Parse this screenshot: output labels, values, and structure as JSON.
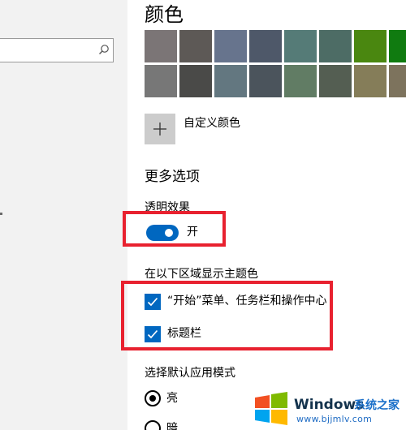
{
  "colors": {
    "heading": "颜色",
    "swatches": [
      "#7b7576",
      "#5d5956",
      "#67748d",
      "#4e5869",
      "#557b77",
      "#4d6c65",
      "#4a8710",
      "#107b10",
      "#777777",
      "#4a4a48",
      "#637780",
      "#4b545c",
      "#617c64",
      "#545e52",
      "#857d59",
      "#7d735d"
    ],
    "custom_label": "自定义颜色"
  },
  "more_options": {
    "heading": "更多选项",
    "transparency_label": "透明效果",
    "transparency_state": "开",
    "transparency_on": true,
    "accent_surfaces_label": "在以下区域显示主题色",
    "checkboxes": [
      {
        "label": "“开始”菜单、任务栏和操作中心",
        "checked": true
      },
      {
        "label": "标题栏",
        "checked": true
      }
    ]
  },
  "app_mode": {
    "label": "选择默认应用模式",
    "options": [
      {
        "label": "亮",
        "selected": true
      },
      {
        "label": "暗",
        "selected": false
      }
    ]
  },
  "theme": {
    "accent": "#0067c0",
    "annotation": "#e8212f"
  },
  "watermark": {
    "brand": "Windows",
    "cn": "系统之家",
    "url": "www.bjjmlv.com"
  }
}
